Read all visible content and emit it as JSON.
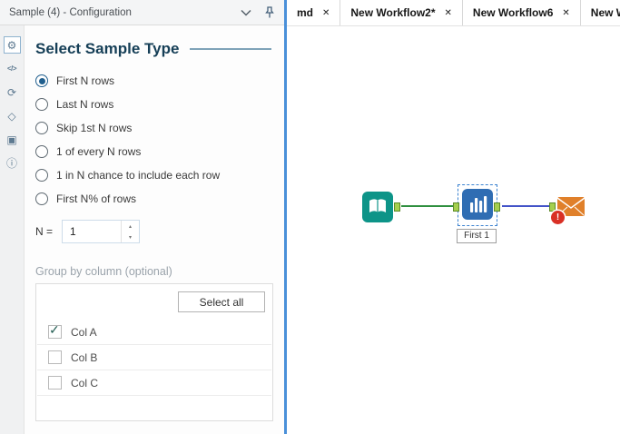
{
  "header": {
    "title": "Sample (4) - Configuration"
  },
  "toolbar_icons": [
    {
      "name": "settings-icon",
      "glyph": "⚙"
    },
    {
      "name": "code-icon",
      "glyph": "</>"
    },
    {
      "name": "sync-icon",
      "glyph": "⟳"
    },
    {
      "name": "tag-icon",
      "glyph": "◇"
    },
    {
      "name": "package-icon",
      "glyph": "▣"
    },
    {
      "name": "info-icon",
      "glyph": "ⓘ"
    }
  ],
  "config": {
    "section_title": "Select Sample Type",
    "options": [
      {
        "label": "First N rows",
        "selected": true
      },
      {
        "label": "Last N rows",
        "selected": false
      },
      {
        "label": "Skip 1st N rows",
        "selected": false
      },
      {
        "label": "1 of every N rows",
        "selected": false
      },
      {
        "label": "1 in N chance to include each row",
        "selected": false
      },
      {
        "label": "First N% of rows",
        "selected": false
      }
    ],
    "n": {
      "label": "N =",
      "value": "1"
    },
    "group_by": {
      "label": "Group by column (optional)",
      "select_all": "Select all",
      "columns": [
        {
          "label": "Col A",
          "checked": true
        },
        {
          "label": "Col B",
          "checked": false
        },
        {
          "label": "Col C",
          "checked": false
        }
      ]
    }
  },
  "tabs": [
    {
      "label": "md"
    },
    {
      "label": "New Workflow2*"
    },
    {
      "label": "New Workflow6"
    },
    {
      "label": "New Workflo"
    }
  ],
  "canvas": {
    "selected_tool_label": "First 1"
  },
  "glyphs": {
    "close": "✕",
    "check": "✓",
    "spin_up": "▴",
    "spin_down": "▾",
    "error": "!"
  },
  "colors": {
    "accent_blue": "#4a90d9",
    "connection_green": "#2f8f3f",
    "connection_blue": "#4353c8",
    "tool_teal": "#0d9488",
    "tool_blue": "#2f6db3",
    "tool_orange": "#e0802a",
    "error_red": "#d93025"
  }
}
